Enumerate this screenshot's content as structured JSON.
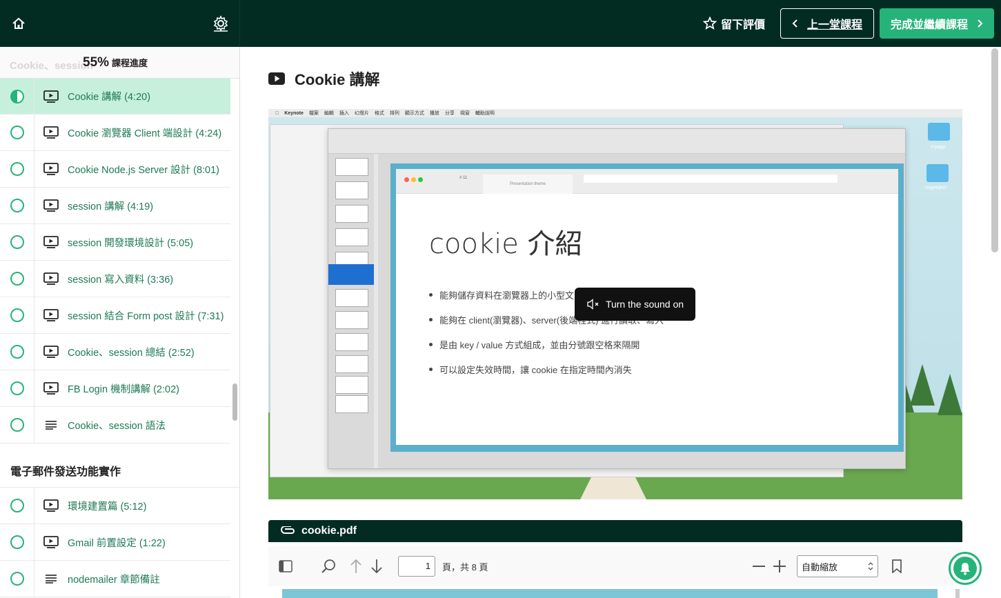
{
  "topbar": {
    "rate_label": "留下評價",
    "prev_label": "上一堂課程",
    "next_label": "完成並繼續課程"
  },
  "sidebar": {
    "ghost_section": "Cookie、session",
    "progress_percent": "55%",
    "progress_label": "課程進度",
    "lessons": [
      {
        "title": "Cookie 講解 (4:20)",
        "type": "video",
        "status": "in-progress"
      },
      {
        "title": "Cookie 瀏覽器 Client 端設計 (4:24)",
        "type": "video",
        "status": "not-started"
      },
      {
        "title": "Cookie Node.js Server 設計 (8:01)",
        "type": "video",
        "status": "not-started"
      },
      {
        "title": "session 講解 (4:19)",
        "type": "video",
        "status": "not-started"
      },
      {
        "title": "session 開發環境設計 (5:05)",
        "type": "video",
        "status": "not-started"
      },
      {
        "title": "session 寫入資料 (3:36)",
        "type": "video",
        "status": "not-started"
      },
      {
        "title": "session 結合 Form post 設計 (7:31)",
        "type": "video",
        "status": "not-started"
      },
      {
        "title": "Cookie、session 總結 (2:52)",
        "type": "video",
        "status": "not-started"
      },
      {
        "title": "FB Login 機制講解 (2:02)",
        "type": "video",
        "status": "not-started"
      },
      {
        "title": "Cookie、session 語法",
        "type": "text",
        "status": "not-started"
      }
    ],
    "section2_title": "電子郵件發送功能實作",
    "lessons2": [
      {
        "title": "環境建置篇 (5:12)",
        "type": "video",
        "status": "not-started"
      },
      {
        "title": "Gmail 前置設定 (1:22)",
        "type": "video",
        "status": "not-started"
      },
      {
        "title": "nodemailer 章節備註",
        "type": "text",
        "status": "not-started"
      }
    ]
  },
  "main": {
    "lesson_title": "Cookie 講解",
    "video": {
      "menubar": [
        "Keynote",
        "檔案",
        "編輯",
        "插入",
        "幻燈片",
        "格式",
        "排列",
        "顯示方式",
        "播放",
        "分享",
        "視窗",
        "輔助說明"
      ],
      "folders": [
        "myapp",
        "myproject"
      ],
      "slide_tab": "Presentation theme",
      "slide_number": "# 11",
      "slide_title": "cookie 介紹",
      "slide_bullets": [
        "能夠儲存資料在瀏覽器上的小型文",
        "能夠在 client(瀏覽器)、server(後端程式) 進行讀取、寫入",
        "是由 key / value 方式組成，並由分號跟空格來隔開",
        "可以設定失效時間，讓 cookie 在指定時間內消失"
      ],
      "sound_label": "Turn the sound on"
    },
    "pdf": {
      "filename": "cookie.pdf",
      "page_value": "1",
      "page_of": "頁，共 8 頁",
      "zoom": "自動縮放"
    }
  },
  "colors": {
    "dark": "#022c22",
    "accent": "#26b37a",
    "active_row": "#c6f0dc"
  }
}
